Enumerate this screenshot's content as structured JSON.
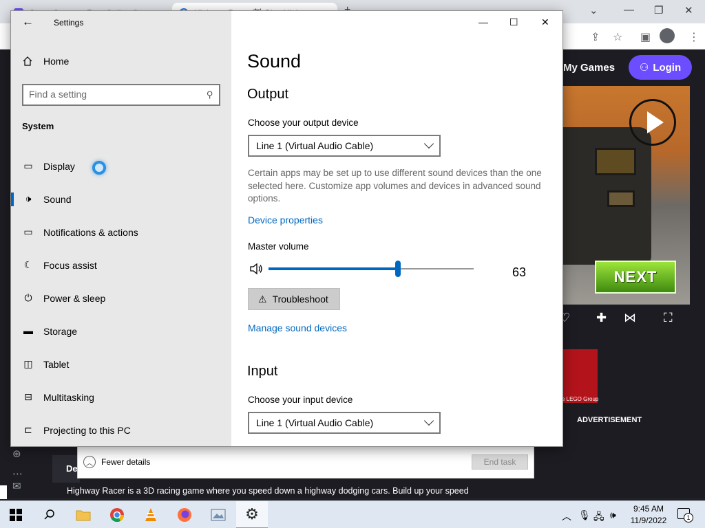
{
  "browser": {
    "tabs": [
      {
        "label": "Crazy Games - Free Online Game"
      },
      {
        "label": "Highway Racer 🏁 Play Highwa"
      }
    ],
    "site": {
      "my_games": "My Games",
      "login": "Login",
      "next_button": "NEXT",
      "ad_label": "ADVERTISEMENT",
      "lego_caption": "e LEGO Group",
      "details_tab": "De",
      "description": "Highway Racer is a 3D racing game where you speed down a highway dodging cars. Build up your speed"
    }
  },
  "taskmgr": {
    "fewer_details": "Fewer details",
    "end_task": "End task"
  },
  "settings": {
    "title": "Settings",
    "home": "Home",
    "search_placeholder": "Find a setting",
    "section": "System",
    "nav": [
      {
        "label": "Display",
        "icon": "display-icon"
      },
      {
        "label": "Sound",
        "icon": "sound-icon",
        "active": true
      },
      {
        "label": "Notifications & actions",
        "icon": "notifications-icon"
      },
      {
        "label": "Focus assist",
        "icon": "moon-icon"
      },
      {
        "label": "Power & sleep",
        "icon": "power-icon"
      },
      {
        "label": "Storage",
        "icon": "storage-icon"
      },
      {
        "label": "Tablet",
        "icon": "tablet-icon"
      },
      {
        "label": "Multitasking",
        "icon": "multitasking-icon"
      },
      {
        "label": "Projecting to this PC",
        "icon": "projecting-icon"
      }
    ],
    "page_title": "Sound",
    "output": {
      "title": "Output",
      "device_label": "Choose your output device",
      "device_value": "Line 1 (Virtual Audio Cable)",
      "info": "Certain apps may be set up to use different sound devices than the one selected here. Customize app volumes and devices in advanced sound options.",
      "device_properties": "Device properties",
      "master_volume_label": "Master volume",
      "master_volume": 63,
      "troubleshoot": "Troubleshoot",
      "manage_devices": "Manage sound devices"
    },
    "input": {
      "title": "Input",
      "device_label": "Choose your input device",
      "device_value": "Line 1 (Virtual Audio Cable)"
    }
  },
  "taskbar": {
    "time": "9:45 AM",
    "date": "11/9/2022",
    "notification_count": "1"
  },
  "colors": {
    "accent": "#0067c0",
    "login_purple": "#6c4dff",
    "sidebar_bg": "#e8e8e8"
  }
}
